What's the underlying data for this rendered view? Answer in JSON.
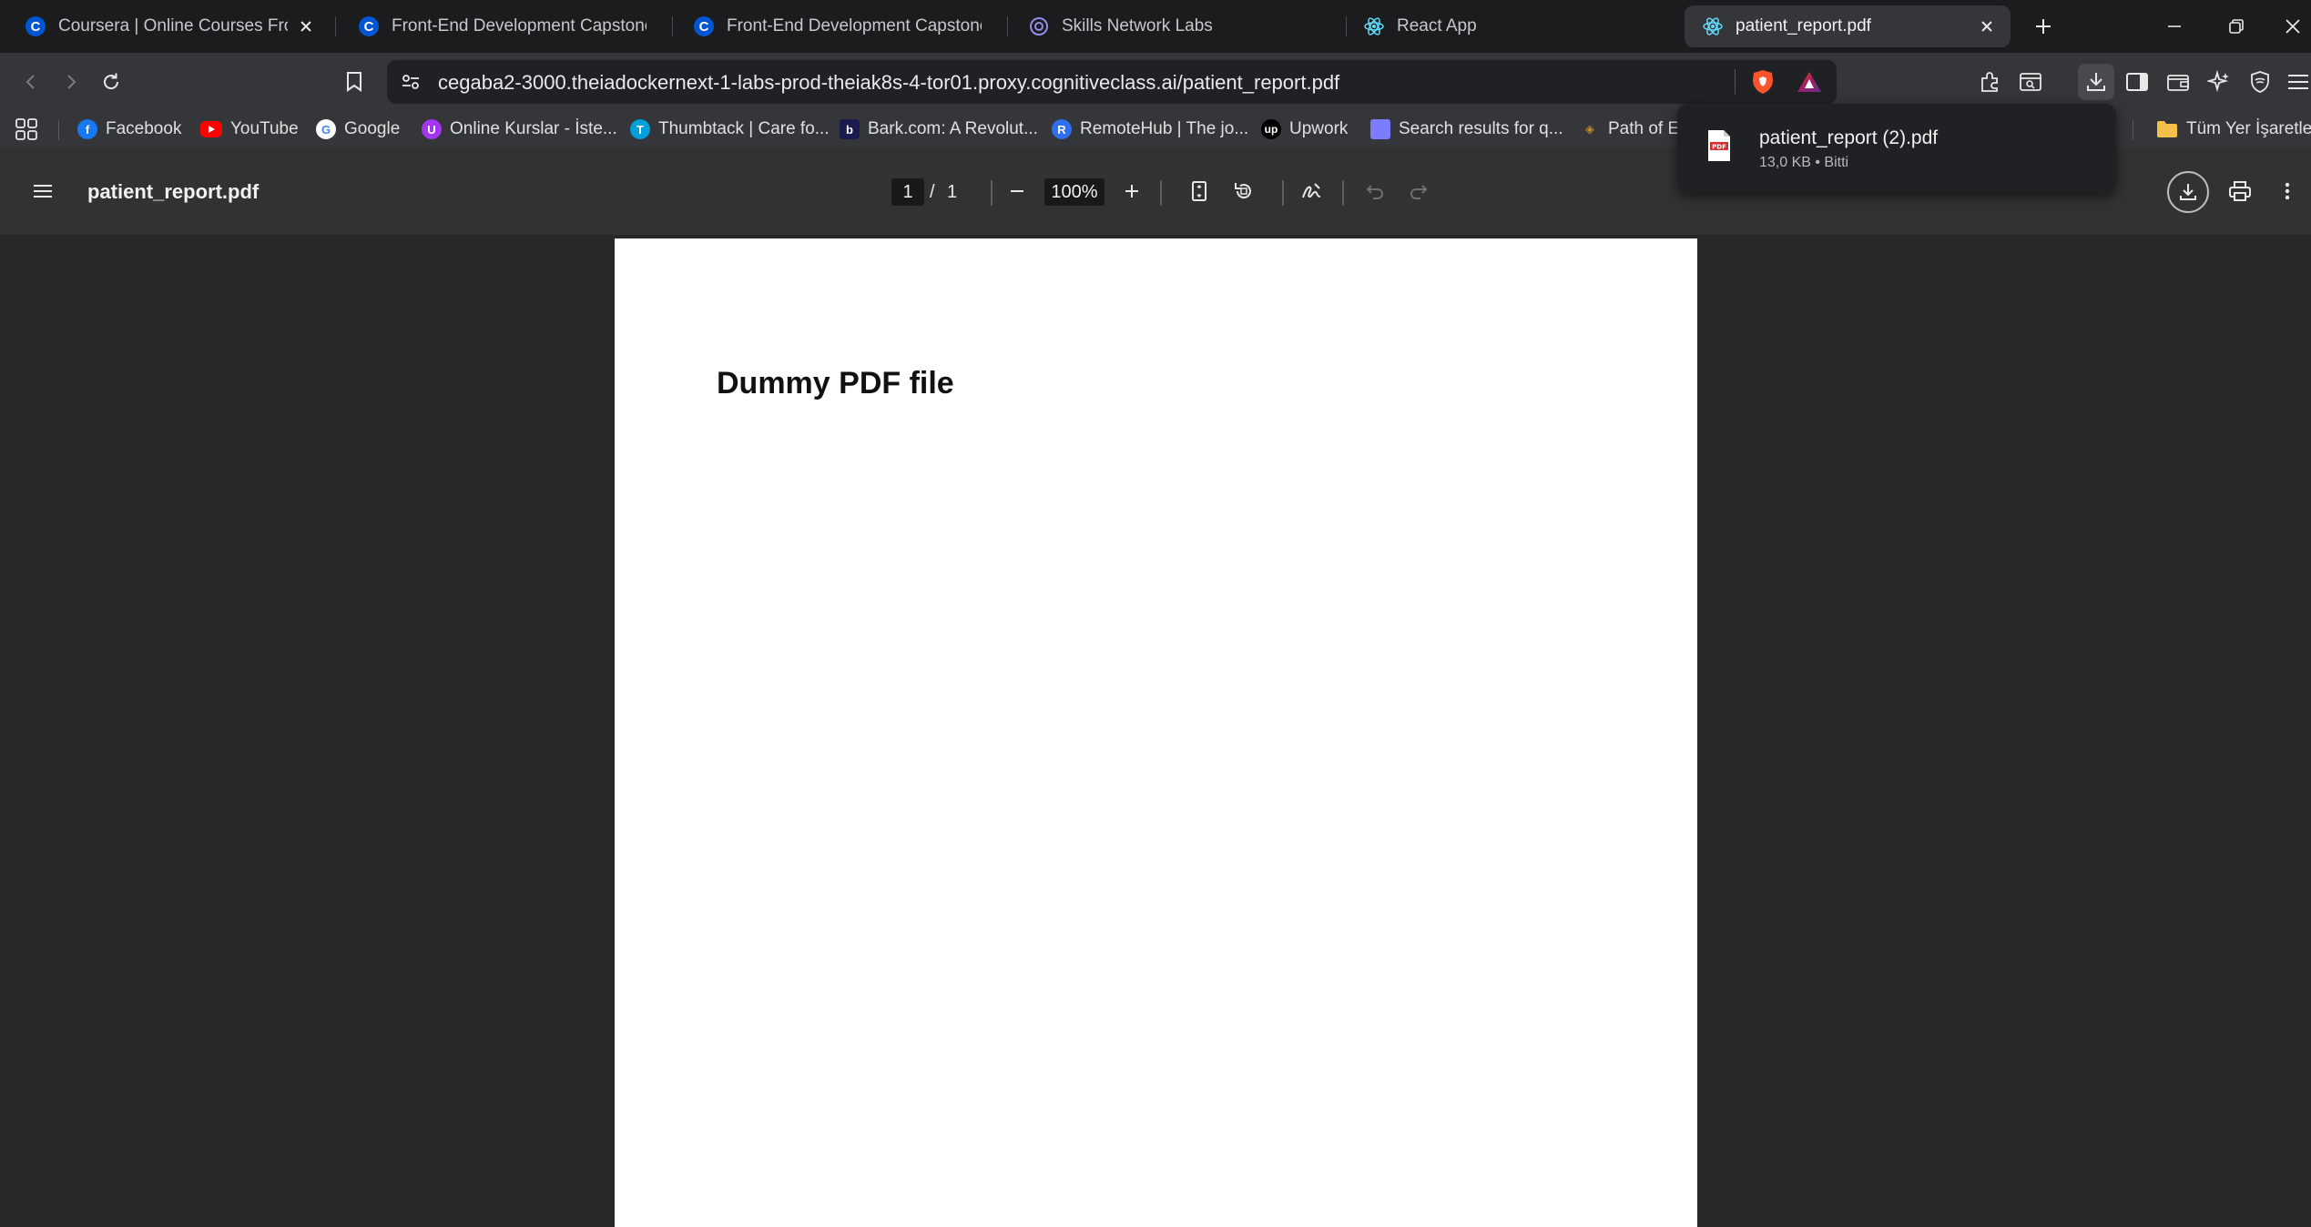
{
  "tabs": [
    {
      "title": "Coursera | Online Courses From",
      "icon": "coursera-icon",
      "active": false,
      "closable": true
    },
    {
      "title": "Front-End Development Capstone Pr",
      "icon": "coursera-icon",
      "active": false
    },
    {
      "title": "Front-End Development Capstone Pr",
      "icon": "coursera-icon",
      "active": false
    },
    {
      "title": "Skills Network Labs",
      "icon": "skills-network-icon",
      "active": false
    },
    {
      "title": "React App",
      "icon": "react-icon",
      "active": false
    },
    {
      "title": "patient_report.pdf",
      "icon": "react-icon",
      "active": true,
      "closable": true
    }
  ],
  "toolbar": {
    "url": "cegaba2-3000.theiadockernext-1-labs-prod-theiak8s-4-tor01.proxy.cognitiveclass.ai/patient_report.pdf"
  },
  "bookmarks": [
    {
      "label": "Facebook",
      "icon": "facebook-icon",
      "color": "#1877f2"
    },
    {
      "label": "YouTube",
      "icon": "youtube-icon",
      "color": "#ff0000"
    },
    {
      "label": "Google",
      "icon": "google-icon",
      "color": "#ffffff"
    },
    {
      "label": "Online Kurslar - İste...",
      "icon": "udemy-icon",
      "color": "#a435f0"
    },
    {
      "label": "Thumbtack | Care fo...",
      "icon": "thumbtack-icon",
      "color": "#009fd9"
    },
    {
      "label": "Bark.com: A Revolut...",
      "icon": "bark-icon",
      "color": "#1a1a4e"
    },
    {
      "label": "RemoteHub | The jo...",
      "icon": "remotehub-icon",
      "color": "#2f6fed"
    },
    {
      "label": "Upwork",
      "icon": "upwork-icon",
      "color": "#000000"
    },
    {
      "label": "Search results for q...",
      "icon": "search-results-icon",
      "color": "#7c7cff"
    },
    {
      "label": "Path of E",
      "icon": "path-of-exile-icon",
      "color": "#c98a2a"
    }
  ],
  "bookmarks_all_label": "Tüm Yer İşaretleri",
  "pdf_viewer": {
    "title": "patient_report.pdf",
    "current_page": "1",
    "page_separator": "/",
    "total_pages": "1",
    "zoom": "100%"
  },
  "document": {
    "heading": "Dummy PDF file"
  },
  "download": {
    "file_name": "patient_report (2).pdf",
    "meta": "13,0 KB • Bitti"
  },
  "colors": {
    "coursera_blue": "#0056d2",
    "brave_orange": "#fb542b"
  }
}
